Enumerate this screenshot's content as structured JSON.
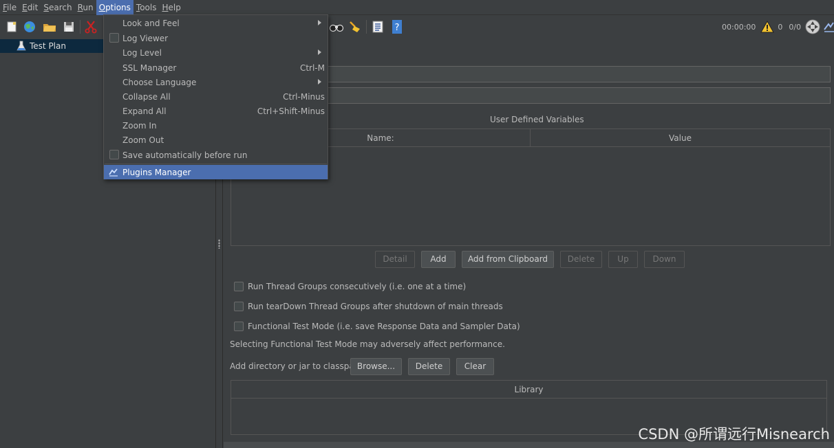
{
  "menubar": {
    "items": [
      "File",
      "Edit",
      "Search",
      "Run",
      "Options",
      "Tools",
      "Help"
    ],
    "mnemonics": [
      "F",
      "E",
      "S",
      "R",
      "O",
      "T",
      "H"
    ],
    "active": "Options"
  },
  "toolbar": {
    "timer": "00:00:00",
    "warning_count": "0",
    "threads": "0/0"
  },
  "tree": {
    "root_label": "Test Plan"
  },
  "main": {
    "user_vars_title": "User Defined Variables",
    "columns": [
      "Name:",
      "Value"
    ],
    "buttons": {
      "detail": "Detail",
      "add": "Add",
      "add_clipboard": "Add from Clipboard",
      "delete": "Delete",
      "up": "Up",
      "down": "Down"
    },
    "checks": {
      "consecutive": "Run Thread Groups consecutively (i.e. one at a time)",
      "teardown": "Run tearDown Thread Groups after shutdown of main threads",
      "functional": "Functional Test Mode (i.e. save Response Data and Sampler Data)"
    },
    "functional_note": "Selecting Functional Test Mode may adversely affect performance.",
    "classpath_label": "Add directory or jar to classpath",
    "classpath_buttons": {
      "browse": "Browse...",
      "delete": "Delete",
      "clear": "Clear"
    },
    "library_header": "Library"
  },
  "options_menu": {
    "items": [
      {
        "label": "Look and Feel",
        "shortcut": "",
        "submenu": true
      },
      {
        "label": "Log Viewer",
        "shortcut": "",
        "checkbox": true
      },
      {
        "label": "Log Level",
        "shortcut": "",
        "submenu": true
      },
      {
        "label": "SSL Manager",
        "shortcut": "Ctrl-M"
      },
      {
        "label": "Choose Language",
        "shortcut": "",
        "submenu": true
      },
      {
        "label": "Collapse All",
        "shortcut": "Ctrl-Minus"
      },
      {
        "label": "Expand All",
        "shortcut": "Ctrl+Shift-Minus"
      },
      {
        "label": "Zoom In",
        "shortcut": ""
      },
      {
        "label": "Zoom Out",
        "shortcut": ""
      },
      {
        "label": "Save automatically before run",
        "shortcut": "",
        "checkbox": true
      },
      {
        "label": "Plugins Manager",
        "shortcut": "",
        "selected": true
      }
    ]
  },
  "watermark": "CSDN @所谓远行Misnearch",
  "colors": {
    "background": "#3c3f41",
    "selection": "#4b6eaf",
    "tree_selection": "#0d293e",
    "text": "#bbbbbb"
  }
}
